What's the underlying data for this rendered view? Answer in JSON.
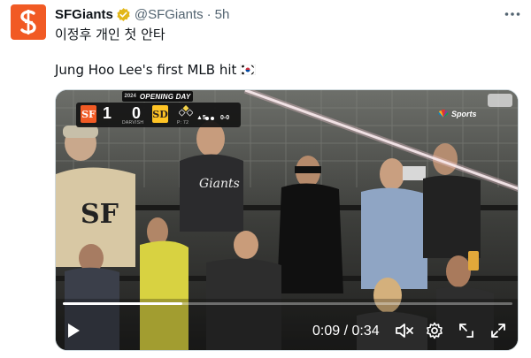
{
  "account": {
    "display_name": "SFGiants",
    "handle": "@SFGiants",
    "separator": "·",
    "time": "5h",
    "avatar_icon": "sf-giants-logo",
    "verified_icon": "verified-gold-badge-icon",
    "brand_color": "#f15a24"
  },
  "post": {
    "line1": "이정후 개인 첫 안타",
    "line2": "Jung Hoo Lee's first MLB hit",
    "flag_icon": "south-korea-flag-icon"
  },
  "scorebug": {
    "year": "2024",
    "event": "OPENING DAY",
    "away_logo": "SF",
    "home_logo": "SD",
    "away_score": "1",
    "home_score": "0",
    "pitcher_left": "DARVISH",
    "pitcher_right": "P: 72",
    "inning": "▲5",
    "count": "0-0"
  },
  "broadcast": {
    "network": "Sports",
    "network_icon": "nbc-peacock-icon",
    "league_icon": "mlb-logo-icon"
  },
  "player": {
    "current_time": "0:09",
    "duration": "0:34",
    "time_display": "0:09 / 0:34",
    "progress_fraction": 0.265
  }
}
